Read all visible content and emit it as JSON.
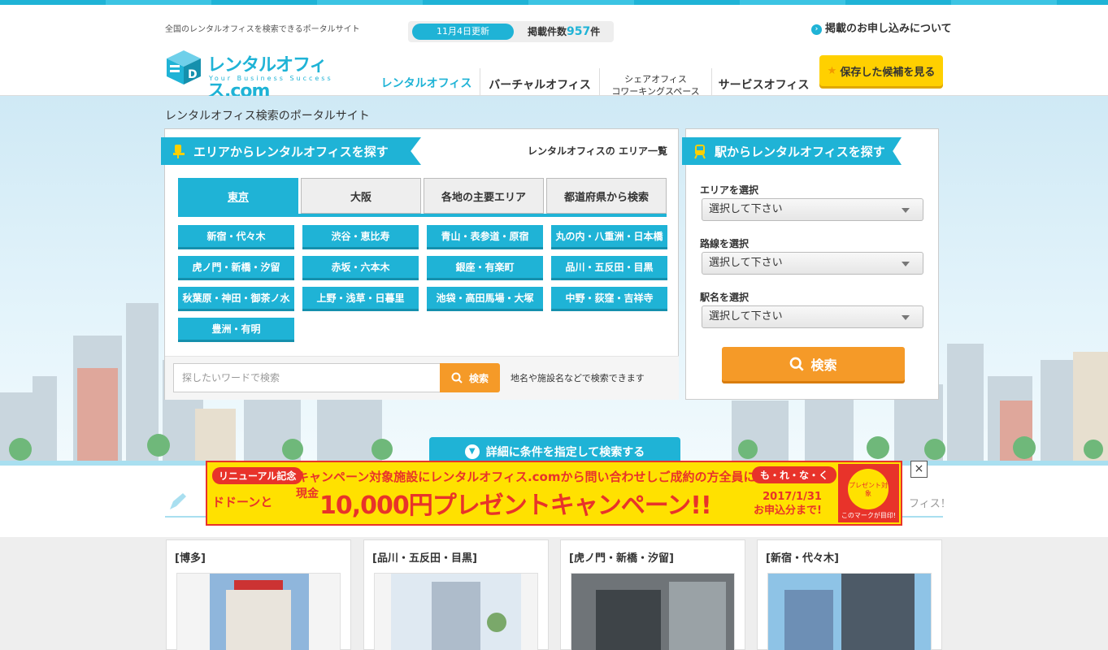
{
  "header": {
    "tagline": "全国のレンタルオフィスを検索できるポータルサイト",
    "update_date": "11月4日更新",
    "count_label": "掲載件数",
    "count_value": "957",
    "count_unit": "件",
    "apply_link": "掲載のお申し込みについて",
    "logo_text": "レンタルオフィス.com",
    "logo_sub": "Your Business Success",
    "nav": [
      {
        "label": "レンタルオフィス"
      },
      {
        "label": "バーチャルオフィス"
      },
      {
        "label": "シェアオフィス",
        "label2": "コワーキングスペース"
      },
      {
        "label": "サービスオフィス"
      }
    ],
    "save_button": "保存した候補を見る"
  },
  "hero": {
    "subtitle": "レンタルオフィス検索のポータルサイト"
  },
  "area_panel": {
    "title": "エリアからレンタルオフィスを探す",
    "area_list_link": "レンタルオフィスの エリア一覧",
    "tabs": [
      "東京",
      "大阪",
      "各地の主要エリア",
      "都道府県から検索"
    ],
    "areas": [
      "新宿・代々木",
      "渋谷・恵比寿",
      "青山・表参道・原宿",
      "丸の内・八重洲・日本橋",
      "虎ノ門・新橋・汐留",
      "赤坂・六本木",
      "銀座・有楽町",
      "品川・五反田・目黒",
      "秋葉原・神田・御茶ノ水",
      "上野・浅草・日暮里",
      "池袋・高田馬場・大塚",
      "中野・荻窪・吉祥寺",
      "豊洲・有明"
    ],
    "search_placeholder": "探したいワードで検索",
    "search_button": "検索",
    "search_note": "地名や施設名などで検索できます"
  },
  "station_panel": {
    "title": "駅からレンタルオフィスを探す",
    "fields": [
      {
        "label": "エリアを選択",
        "value": "選択して下さい"
      },
      {
        "label": "路線を選択",
        "value": "選択して下さい"
      },
      {
        "label": "駅名を選択",
        "value": "選択して下さい"
      }
    ],
    "search_button": "検索"
  },
  "detail_bar": "詳細に条件を指定して検索する",
  "section2_tail": "フィス！",
  "banner": {
    "tag1": "リニューアル記念",
    "top_text": "キャンペーン対象施設にレンタルオフィス.comから問い合わせしご成約の方全員に!",
    "tag2": "も・れ・な・く",
    "dodon": "ドドーンと",
    "cash": "現金",
    "main": "10,000円プレゼントキャンペーン!!",
    "date1": "2017/1/31",
    "date2": "お申込分まで!",
    "badge": "プレゼント対象",
    "badge_caption": "このマークが目印!"
  },
  "cards": [
    {
      "title": "[博多]"
    },
    {
      "title": "[品川・五反田・目黒]"
    },
    {
      "title": "[虎ノ門・新橋・汐留]"
    },
    {
      "title": "[新宿・代々木]"
    }
  ],
  "colors": {
    "accent": "#1fb3d6",
    "orange": "#f59a28",
    "yellow": "#ffd000",
    "red": "#e8332a"
  }
}
